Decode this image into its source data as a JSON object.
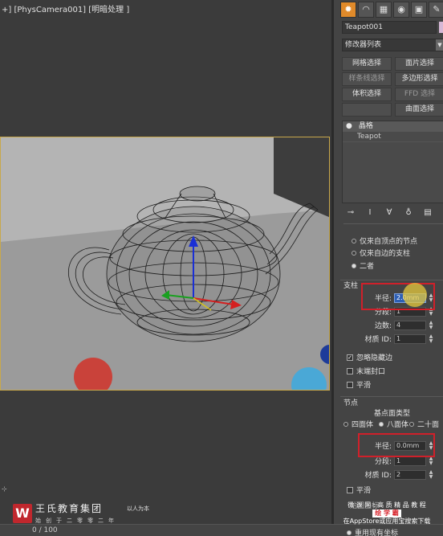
{
  "viewport": {
    "label": "+] [PhysCamera001] [明暗处理 ]"
  },
  "logo": {
    "mark": "W",
    "title": "王氏教育集团",
    "subtitle": "始创于二零零二年",
    "slogan": "以人为本"
  },
  "timeline": {
    "text": "0 / 100"
  },
  "panel": {
    "tabs": [
      "✹",
      "◠",
      "▦",
      "◉",
      "▣",
      "✎"
    ],
    "object_name": "Teapot001",
    "object_color": "#d6b8d6",
    "modifier_list": "修改器列表",
    "modifier_buttons": [
      {
        "label": "网格选择",
        "dim": false
      },
      {
        "label": "面片选择",
        "dim": false
      },
      {
        "label": "样条线选择",
        "dim": true
      },
      {
        "label": "多边形选择",
        "dim": false
      },
      {
        "label": "体积选择",
        "dim": false
      },
      {
        "label": "FFD 选择",
        "dim": true
      },
      {
        "label": "",
        "dim": true
      },
      {
        "label": "曲面选择",
        "dim": false
      }
    ],
    "stack": {
      "top_icon": "●",
      "top_label": "晶格",
      "item": "Teapot"
    },
    "stack_tools": [
      "⊸",
      "Ⅰ",
      "∀",
      "♁",
      "▤"
    ],
    "geometry_radios": [
      {
        "label": "仅来自顶点的节点",
        "on": false
      },
      {
        "label": "仅来自边的支柱",
        "on": false
      },
      {
        "label": "二者",
        "on": true
      }
    ],
    "struts": {
      "title": "支柱",
      "radius_label": "半径:",
      "radius_value": "2.0mm",
      "segments_label": "分段:",
      "segments_value": "1",
      "sides_label": "边数:",
      "sides_value": "4",
      "material_label": "材质 ID:",
      "material_value": "1",
      "ignore_hidden": "忽略隐藏边",
      "ignore_hidden_checked": true,
      "end_caps": "末端封口",
      "end_caps_checked": false,
      "smooth": "平滑",
      "smooth_checked": false
    },
    "joints": {
      "title": "节点",
      "type_label": "基点面类型",
      "types": [
        {
          "label": "四面体",
          "on": false
        },
        {
          "label": "八面体",
          "on": true
        },
        {
          "label": "二十面",
          "on": false
        }
      ],
      "radius_label": "半径:",
      "radius_value": "0.0mm",
      "segments_label": "分段:",
      "segments_value": "1",
      "material_label": "材质 ID:",
      "material_value": "2",
      "smooth": "平滑",
      "smooth_checked": false
    },
    "mapping_title": "贴图坐标",
    "use_existing": "重用现有坐标"
  },
  "watermark": {
    "line1": "微 课 网 : 高 质 精 品 教 程",
    "brand": "绘 学 霸",
    "line3": "在AppStore或应用宝搜索下载"
  }
}
